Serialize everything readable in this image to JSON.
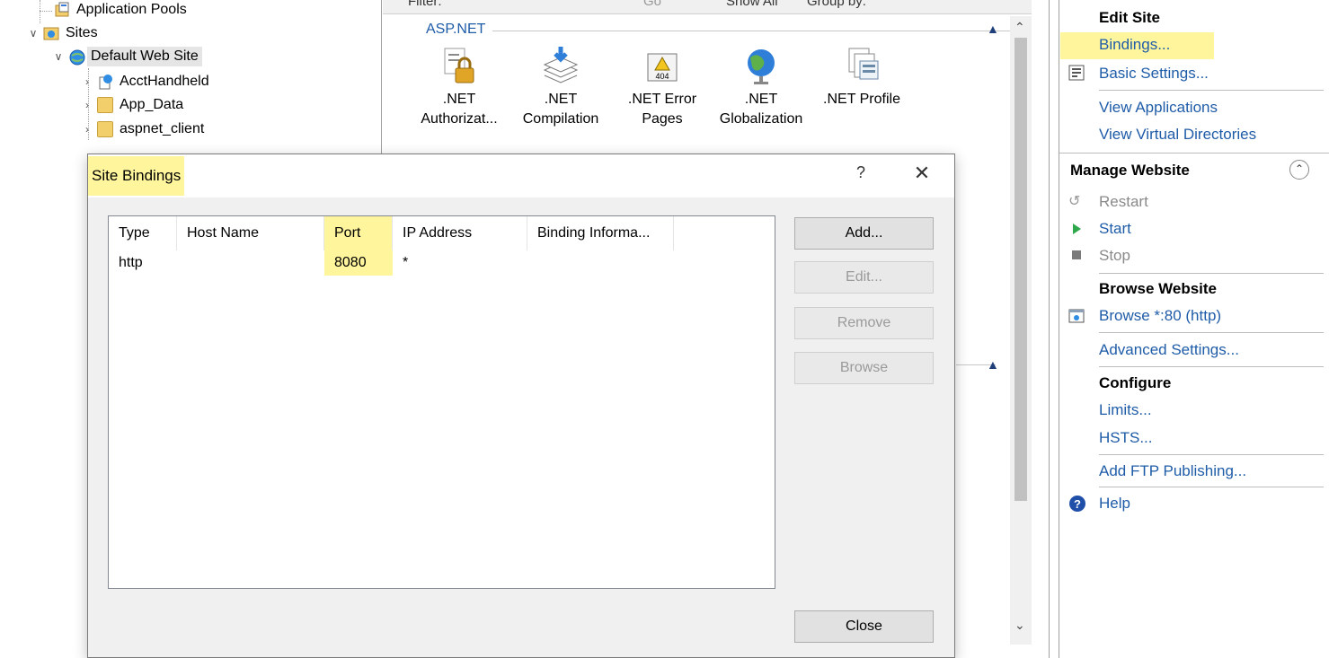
{
  "tree": {
    "items": [
      {
        "label": "Application Pools"
      },
      {
        "label": "Sites"
      },
      {
        "label": "Default Web Site"
      },
      {
        "label": "AcctHandheld"
      },
      {
        "label": "App_Data"
      },
      {
        "label": "aspnet_client"
      }
    ]
  },
  "center": {
    "toolbar": {
      "filter": "Filter:",
      "go": "Go",
      "show_all": "Show All",
      "group_by": "Group by:"
    },
    "group_name": "ASP.NET",
    "features": [
      {
        "line1": ".NET",
        "line2": "Authorizat...",
        "icon": "lock-document-icon"
      },
      {
        "line1": ".NET",
        "line2": "Compilation",
        "icon": "stack-arrow-icon"
      },
      {
        "line1": ".NET Error",
        "line2": "Pages",
        "icon": "warning-404-icon"
      },
      {
        "line1": ".NET",
        "line2": "Globalization",
        "icon": "globe-icon"
      },
      {
        "line1": ".NET Profile",
        "line2": "",
        "icon": "profile-window-icon"
      }
    ]
  },
  "actions": {
    "edit_site": {
      "heading": "Edit Site",
      "links": [
        "Bindings...",
        "Basic Settings...",
        "View Applications",
        "View Virtual Directories"
      ]
    },
    "manage": {
      "heading": "Manage Website",
      "items": [
        "Restart",
        "Start",
        "Stop"
      ]
    },
    "browse": {
      "heading": "Browse Website",
      "link": "Browse *:80 (http)"
    },
    "advanced": "Advanced Settings...",
    "configure": {
      "heading": "Configure",
      "links": [
        "Limits...",
        "HSTS..."
      ]
    },
    "ftp": "Add FTP Publishing...",
    "help": "Help"
  },
  "dialog": {
    "title": "Site Bindings",
    "help_glyph": "?",
    "close_glyph": "✕",
    "columns": [
      "Type",
      "Host Name",
      "Port",
      "IP Address",
      "Binding Informa..."
    ],
    "rows": [
      {
        "type": "http",
        "host": "",
        "port": "8080",
        "ip": "*",
        "info": ""
      }
    ],
    "buttons": {
      "add": "Add...",
      "edit": "Edit...",
      "remove": "Remove",
      "browse": "Browse",
      "close": "Close"
    }
  },
  "colors": {
    "highlight": "#fff59d",
    "link": "#1f5ca8",
    "selected_row": "#e5e5e5"
  }
}
